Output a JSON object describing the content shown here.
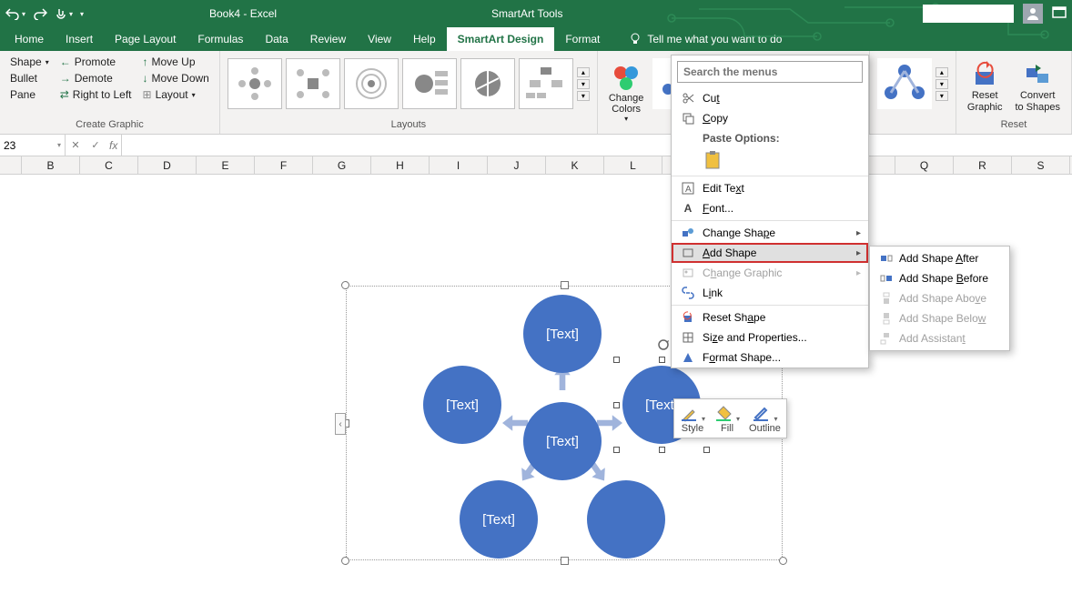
{
  "title": {
    "document": "Book4  -  Excel",
    "tools": "SmartArt Tools"
  },
  "tabs": [
    "Home",
    "Insert",
    "Page Layout",
    "Formulas",
    "Data",
    "Review",
    "View",
    "Help",
    "SmartArt Design",
    "Format"
  ],
  "active_tab": "SmartArt Design",
  "tellme": "Tell me what you want to do",
  "ribbon": {
    "create_graphic": {
      "label": "Create Graphic",
      "shape": "Shape",
      "bullet": "Bullet",
      "pane": "Pane",
      "promote": "Promote",
      "demote": "Demote",
      "rtl": "Right to Left",
      "moveup": "Move Up",
      "movedown": "Move Down",
      "layout": "Layout"
    },
    "layouts_label": "Layouts",
    "change_colors": "Change\nColors",
    "reset_label": "Reset",
    "reset_graphic": "Reset\nGraphic",
    "convert": "Convert\nto Shapes"
  },
  "formula_bar": {
    "name_box": "23",
    "cancel": "✕",
    "enter": "✓",
    "fx": "fx"
  },
  "columns": [
    "B",
    "C",
    "D",
    "E",
    "F",
    "G",
    "H",
    "I",
    "J",
    "K",
    "L",
    "",
    "",
    "",
    "",
    "Q",
    "R",
    "S"
  ],
  "smartart": {
    "placeholder": "[Text]"
  },
  "mini_toolbar": {
    "style": "Style",
    "fill": "Fill",
    "outline": "Outline"
  },
  "context_menu": {
    "search_placeholder": "Search the menus",
    "cut": "Cut",
    "copy": "Copy",
    "paste_options": "Paste Options:",
    "edit_text": "Edit Text",
    "font": "Font...",
    "change_shape": "Change Shape",
    "add_shape": "Add Shape",
    "change_graphic": "Change Graphic",
    "link": "Link",
    "reset_shape": "Reset Shape",
    "size_props": "Size and Properties...",
    "format_shape": "Format Shape..."
  },
  "submenu": {
    "after": "Add Shape After",
    "before": "Add Shape Before",
    "above": "Add Shape Above",
    "below": "Add Shape Below",
    "assistant": "Add Assistant"
  }
}
